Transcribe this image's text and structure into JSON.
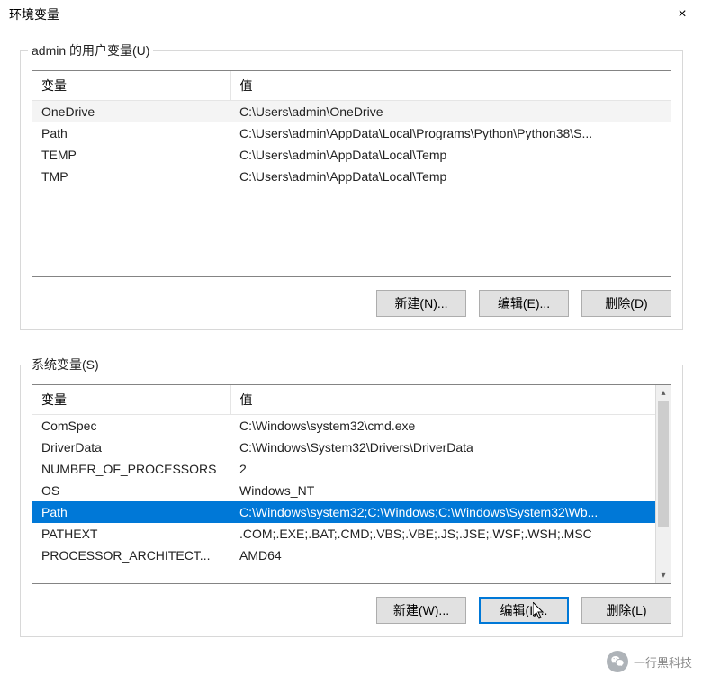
{
  "title": "环境变量",
  "close_label": "×",
  "user_section": {
    "legend": "admin 的用户变量(U)",
    "headers": {
      "variable": "变量",
      "value": "值"
    },
    "rows": [
      {
        "variable": "OneDrive",
        "value": "C:\\Users\\admin\\OneDrive"
      },
      {
        "variable": "Path",
        "value": "C:\\Users\\admin\\AppData\\Local\\Programs\\Python\\Python38\\S..."
      },
      {
        "variable": "TEMP",
        "value": "C:\\Users\\admin\\AppData\\Local\\Temp"
      },
      {
        "variable": "TMP",
        "value": "C:\\Users\\admin\\AppData\\Local\\Temp"
      }
    ],
    "buttons": {
      "new": "新建(N)...",
      "edit": "编辑(E)...",
      "delete": "删除(D)"
    }
  },
  "system_section": {
    "legend": "系统变量(S)",
    "headers": {
      "variable": "变量",
      "value": "值"
    },
    "rows": [
      {
        "variable": "ComSpec",
        "value": "C:\\Windows\\system32\\cmd.exe"
      },
      {
        "variable": "DriverData",
        "value": "C:\\Windows\\System32\\Drivers\\DriverData"
      },
      {
        "variable": "NUMBER_OF_PROCESSORS",
        "value": "2"
      },
      {
        "variable": "OS",
        "value": "Windows_NT"
      },
      {
        "variable": "Path",
        "value": "C:\\Windows\\system32;C:\\Windows;C:\\Windows\\System32\\Wb..."
      },
      {
        "variable": "PATHEXT",
        "value": ".COM;.EXE;.BAT;.CMD;.VBS;.VBE;.JS;.JSE;.WSF;.WSH;.MSC"
      },
      {
        "variable": "PROCESSOR_ARCHITECT...",
        "value": "AMD64"
      }
    ],
    "selected_index": 4,
    "buttons": {
      "new": "新建(W)...",
      "edit": "编辑(I)...",
      "delete": "删除(L)"
    }
  },
  "watermark": "一行黑科技"
}
